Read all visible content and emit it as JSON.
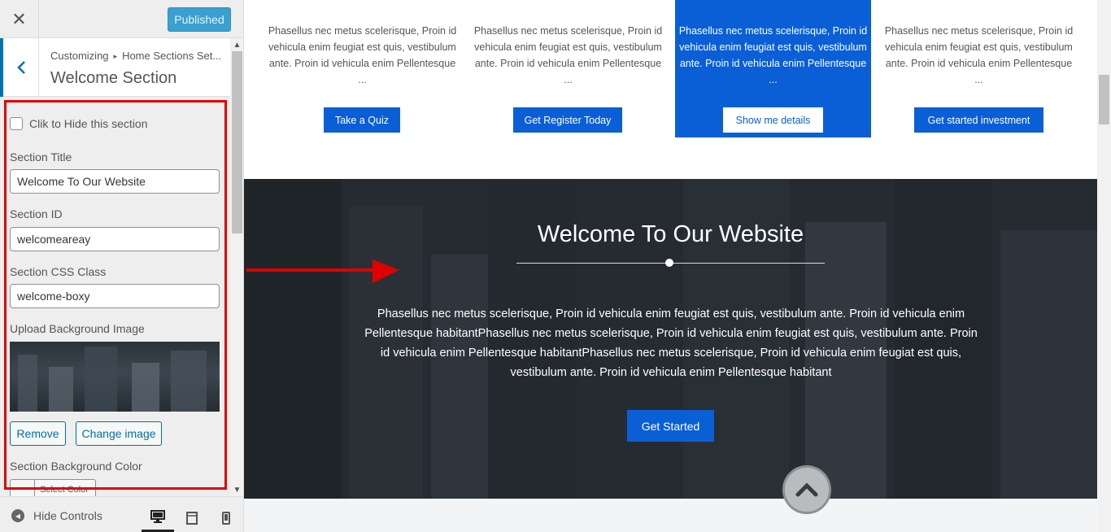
{
  "topbar": {
    "close_label": "✕",
    "published_label": "Published"
  },
  "section_header": {
    "breadcrumb_root": "Customizing",
    "breadcrumb_arrow": "▸",
    "breadcrumb_parent": "Home Sections Set...",
    "title": "Welcome Section"
  },
  "controls": {
    "hide_label": "Clik to Hide this section",
    "title_label": "Section Title",
    "title_value": "Welcome To Our Website",
    "id_label": "Section ID",
    "id_value": "welcomeareay",
    "css_label": "Section CSS Class",
    "css_value": "welcome-boxy",
    "bg_image_label": "Upload Background Image",
    "remove_label": "Remove",
    "change_label": "Change image",
    "bg_color_label": "Section Background Color",
    "select_color_label": "Select Color"
  },
  "footer": {
    "hide_controls_label": "Hide Controls"
  },
  "cards": [
    {
      "text": "Phasellus nec metus scelerisque, Proin id vehicula enim feugiat est quis, vestibulum ante. Proin id vehicula enim Pellentesque ...",
      "button": "Take a Quiz",
      "active": false
    },
    {
      "text": "Phasellus nec metus scelerisque, Proin id vehicula enim feugiat est quis, vestibulum ante. Proin id vehicula enim Pellentesque ...",
      "button": "Get Register Today",
      "active": false
    },
    {
      "text": "Phasellus nec metus scelerisque, Proin id vehicula enim feugiat est quis, vestibulum ante. Proin id vehicula enim Pellentesque ...",
      "button": "Show me details",
      "active": true
    },
    {
      "text": "Phasellus nec metus scelerisque, Proin id vehicula enim feugiat est quis, vestibulum ante. Proin id vehicula enim Pellentesque ...",
      "button": "Get started investment",
      "active": false
    }
  ],
  "welcome": {
    "title": "Welcome To Our Website",
    "text": "Phasellus nec metus scelerisque, Proin id vehicula enim feugiat est quis, vestibulum ante. Proin id vehicula enim Pellentesque habitantPhasellus nec metus scelerisque, Proin id vehicula enim feugiat est quis, vestibulum ante. Proin id vehicula enim Pellentesque habitantPhasellus nec metus scelerisque, Proin id vehicula enim feugiat est quis, vestibulum ante. Proin id vehicula enim Pellentesque habitant",
    "button": "Get Started"
  },
  "colors": {
    "accent": "#0a5fd6",
    "wp_blue": "#0073aa",
    "published": "#3aa0cf",
    "highlight": "#e00000"
  },
  "icons": {
    "close": "close-icon",
    "back": "chevron-left-icon",
    "hide_controls": "collapse-icon",
    "devices": [
      "desktop-icon",
      "tablet-icon",
      "mobile-icon"
    ],
    "scroll_top": "chevron-up-icon"
  }
}
